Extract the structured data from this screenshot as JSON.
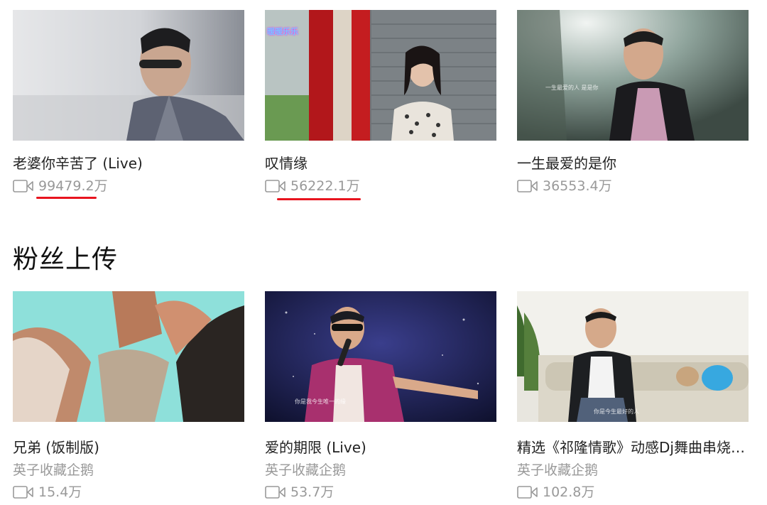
{
  "top_row": [
    {
      "title": "老婆你辛苦了 (Live)",
      "views": "99479.2万"
    },
    {
      "title": "叹情缘",
      "views": "56222.1万",
      "thumb_logo": "暖暖乐乐"
    },
    {
      "title": "一生最爱的是你",
      "views": "36553.4万",
      "thumb_caption": "一生最爱的人 是是你"
    }
  ],
  "section": {
    "title": "粉丝上传"
  },
  "bottom_row": [
    {
      "title": "兄弟 (饭制版)",
      "uploader": "英子收藏企鹅",
      "views": "15.4万"
    },
    {
      "title": "爱的期限 (Live)",
      "uploader": "英子收藏企鹅",
      "views": "53.7万",
      "thumb_caption": "你是我今生唯一的缘"
    },
    {
      "title": "精选《祁隆情歌》动感Dj舞曲串烧 ...",
      "uploader": "英子收藏企鹅",
      "views": "102.8万",
      "thumb_caption": "你是今生最好的人"
    }
  ],
  "colors": {
    "annotation_underline": "#e8141e",
    "meta_text": "#999999"
  },
  "icons": {
    "views": "video-camera-icon"
  }
}
